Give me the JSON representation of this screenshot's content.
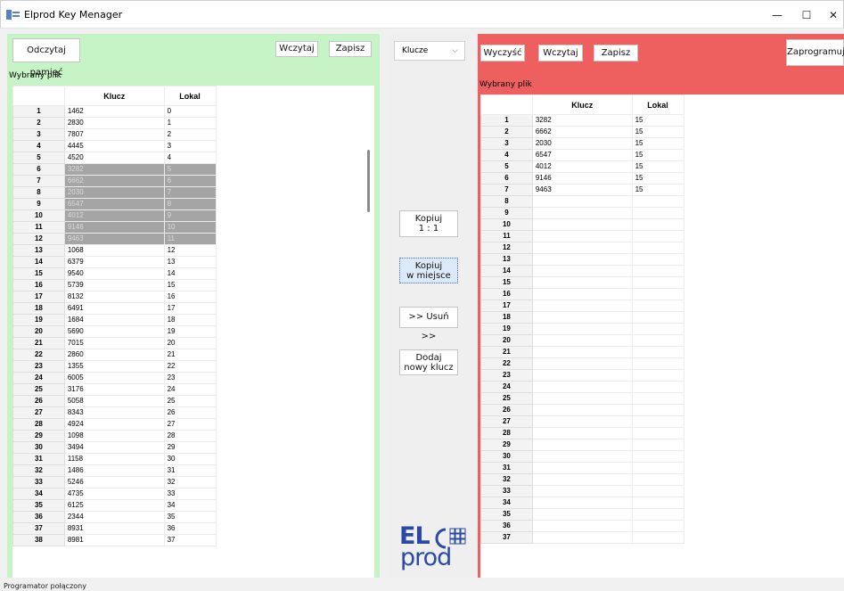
{
  "window": {
    "title": "Elprod Key Menager",
    "minimize": "—",
    "maximize": "☐",
    "close": "✕"
  },
  "left": {
    "read_memory_label": "Odczytaj pamięć",
    "load_label": "Wczytaj",
    "save_label": "Zapisz",
    "selected_file_label": "Wybrany plik",
    "columns": [
      "Klucz",
      "Lokal"
    ],
    "selected_rows": [
      6,
      7,
      8,
      9,
      10,
      11,
      12
    ],
    "rows": [
      [
        "1",
        "1462",
        "0"
      ],
      [
        "2",
        "2830",
        "1"
      ],
      [
        "3",
        "7807",
        "2"
      ],
      [
        "4",
        "4445",
        "3"
      ],
      [
        "5",
        "4520",
        "4"
      ],
      [
        "6",
        "3282",
        "5"
      ],
      [
        "7",
        "6662",
        "6"
      ],
      [
        "8",
        "2030",
        "7"
      ],
      [
        "9",
        "6547",
        "8"
      ],
      [
        "10",
        "4012",
        "9"
      ],
      [
        "11",
        "9146",
        "10"
      ],
      [
        "12",
        "9463",
        "11"
      ],
      [
        "13",
        "1068",
        "12"
      ],
      [
        "14",
        "6379",
        "13"
      ],
      [
        "15",
        "9540",
        "14"
      ],
      [
        "16",
        "5739",
        "15"
      ],
      [
        "17",
        "8132",
        "16"
      ],
      [
        "18",
        "6491",
        "17"
      ],
      [
        "19",
        "1684",
        "18"
      ],
      [
        "20",
        "5690",
        "19"
      ],
      [
        "21",
        "7015",
        "20"
      ],
      [
        "22",
        "2860",
        "21"
      ],
      [
        "23",
        "1355",
        "22"
      ],
      [
        "24",
        "6005",
        "23"
      ],
      [
        "25",
        "3176",
        "24"
      ],
      [
        "26",
        "5058",
        "25"
      ],
      [
        "27",
        "8343",
        "26"
      ],
      [
        "28",
        "4924",
        "27"
      ],
      [
        "29",
        "1098",
        "28"
      ],
      [
        "30",
        "3494",
        "29"
      ],
      [
        "31",
        "1158",
        "30"
      ],
      [
        "32",
        "1486",
        "31"
      ],
      [
        "33",
        "5246",
        "32"
      ],
      [
        "34",
        "4735",
        "33"
      ],
      [
        "35",
        "6125",
        "34"
      ],
      [
        "36",
        "2344",
        "35"
      ],
      [
        "37",
        "8931",
        "36"
      ],
      [
        "38",
        "8981",
        "37"
      ]
    ]
  },
  "middle": {
    "dropdown_value": "Klucze",
    "copy_1to1_line1": "Kopiuj",
    "copy_1to1_line2": "1 : 1",
    "copy_inplace_line1": "Kopiuj",
    "copy_inplace_line2": "w miejsce",
    "delete_label": ">> Usuń >>",
    "add_key_line1": "Dodaj",
    "add_key_line2": "nowy klucz",
    "logo_line1": "EL",
    "logo_line2": "prod"
  },
  "right": {
    "clear_label": "Wyczyść",
    "load_label": "Wczytaj",
    "save_label": "Zapisz",
    "program_label": "Zaprogramuj",
    "selected_file_label": "Wybrany plik",
    "columns": [
      "Klucz",
      "Lokal"
    ],
    "rows": [
      [
        "1",
        "3282",
        "15"
      ],
      [
        "2",
        "6662",
        "15"
      ],
      [
        "3",
        "2030",
        "15"
      ],
      [
        "4",
        "6547",
        "15"
      ],
      [
        "5",
        "4012",
        "15"
      ],
      [
        "6",
        "9146",
        "15"
      ],
      [
        "7",
        "9463",
        "15"
      ],
      [
        "8",
        "",
        ""
      ],
      [
        "9",
        "",
        ""
      ],
      [
        "10",
        "",
        ""
      ],
      [
        "11",
        "",
        ""
      ],
      [
        "12",
        "",
        ""
      ],
      [
        "13",
        "",
        ""
      ],
      [
        "14",
        "",
        ""
      ],
      [
        "15",
        "",
        ""
      ],
      [
        "16",
        "",
        ""
      ],
      [
        "17",
        "",
        ""
      ],
      [
        "18",
        "",
        ""
      ],
      [
        "19",
        "",
        ""
      ],
      [
        "20",
        "",
        ""
      ],
      [
        "21",
        "",
        ""
      ],
      [
        "22",
        "",
        ""
      ],
      [
        "23",
        "",
        ""
      ],
      [
        "24",
        "",
        ""
      ],
      [
        "25",
        "",
        ""
      ],
      [
        "26",
        "",
        ""
      ],
      [
        "27",
        "",
        ""
      ],
      [
        "28",
        "",
        ""
      ],
      [
        "29",
        "",
        ""
      ],
      [
        "30",
        "",
        ""
      ],
      [
        "31",
        "",
        ""
      ],
      [
        "32",
        "",
        ""
      ],
      [
        "33",
        "",
        ""
      ],
      [
        "34",
        "",
        ""
      ],
      [
        "35",
        "",
        ""
      ],
      [
        "36",
        "",
        ""
      ],
      [
        "37",
        "",
        ""
      ]
    ]
  },
  "status": {
    "text": "Programator połączony"
  }
}
